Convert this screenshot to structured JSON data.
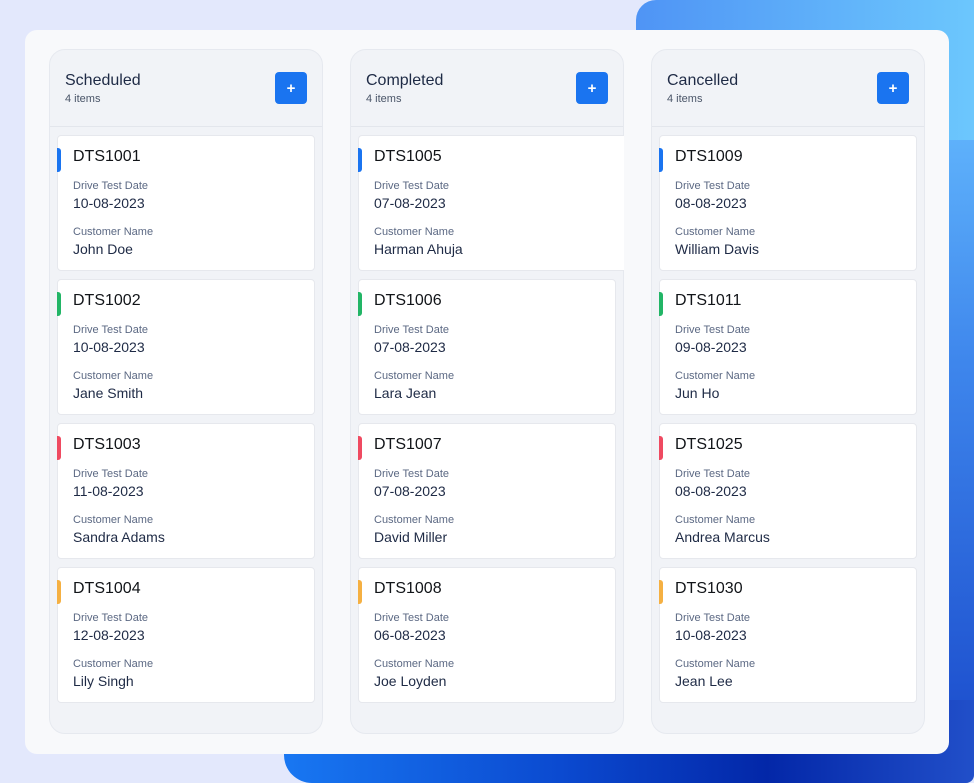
{
  "colors": {
    "accent_blue": "#1a74f0",
    "accent_green": "#22b566",
    "accent_red": "#ef4a61",
    "accent_orange": "#f5b042"
  },
  "labels": {
    "date": "Drive Test Date",
    "customer": "Customer Name",
    "add": "+"
  },
  "columns": [
    {
      "title": "Scheduled",
      "count": "4 items",
      "cards": [
        {
          "id": "DTS1001",
          "date": "10-08-2023",
          "customer": "John Doe",
          "accent": "blue"
        },
        {
          "id": "DTS1002",
          "date": "10-08-2023",
          "customer": "Jane Smith",
          "accent": "green"
        },
        {
          "id": "DTS1003",
          "date": "11-08-2023",
          "customer": "Sandra Adams",
          "accent": "red"
        },
        {
          "id": "DTS1004",
          "date": "12-08-2023",
          "customer": "Lily Singh",
          "accent": "orange"
        }
      ]
    },
    {
      "title": "Completed",
      "count": "4 items",
      "cards": [
        {
          "id": "DTS1005",
          "date": "07-08-2023",
          "customer": "Harman Ahuja",
          "accent": "blue"
        },
        {
          "id": "DTS1006",
          "date": "07-08-2023",
          "customer": "Lara Jean",
          "accent": "green"
        },
        {
          "id": "DTS1007",
          "date": "07-08-2023",
          "customer": "David Miller",
          "accent": "red"
        },
        {
          "id": "DTS1008",
          "date": "06-08-2023",
          "customer": "Joe Loyden",
          "accent": "orange"
        }
      ]
    },
    {
      "title": "Cancelled",
      "count": "4 items",
      "cards": [
        {
          "id": "DTS1009",
          "date": "08-08-2023",
          "customer": "William Davis",
          "accent": "blue"
        },
        {
          "id": "DTS1011",
          "date": "09-08-2023",
          "customer": "Jun Ho",
          "accent": "green"
        },
        {
          "id": "DTS1025",
          "date": "08-08-2023",
          "customer": "Andrea Marcus",
          "accent": "red"
        },
        {
          "id": "DTS1030",
          "date": "10-08-2023",
          "customer": "Jean Lee",
          "accent": "orange"
        }
      ]
    }
  ]
}
